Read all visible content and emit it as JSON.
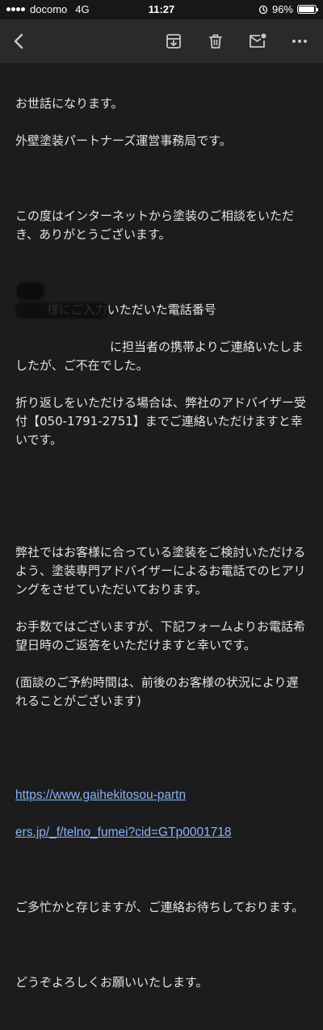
{
  "status_bar": {
    "carrier": "docomo",
    "network": "4G",
    "time": "11:27",
    "battery_percent": "96%",
    "battery_level": 0.96
  },
  "toolbar": {
    "back_icon": "arrow-left-icon",
    "actions": [
      {
        "icon": "archive-icon"
      },
      {
        "icon": "trash-icon"
      },
      {
        "icon": "mark-unread-icon"
      },
      {
        "icon": "more-icon"
      }
    ]
  },
  "email": {
    "greeting": [
      "お世話になります。",
      "外壁塗装パートナーズ運営事務局です。"
    ],
    "thanks": "この度はインターネットから塗装のご相談をいただき、ありがとうございます。",
    "notice_lines": [
      "様にご入力いただいた電話番号",
      "に担当者の携帯よりご連絡いたしましたが、ご不在でした。",
      "折り返しをいただける場合は、弊社のアドバイザー受付【050-1791-2751】までご連絡いただけますと幸いです。"
    ],
    "request_lines": [
      "弊社ではお客様に合っている塗装をご検討いただけるよう、塗装専門アドバイザーによるお電話でのヒアリングをさせていただいております。",
      "お手数ではございますが、下記フォームよりお電話希望日時のご返答をいただけますと幸いです。",
      "(面談のご予約時間は、前後のお客様の状況により遅れることがございます)"
    ],
    "link_line1": "https://www.gaihekitosou-partn",
    "link_line2": "ers.jp/_f/telno_fumei?cid=GTp0001718",
    "busy": "ご多忙かと存じますが、ご連絡お待ちしております。",
    "closing": "どうぞよろしくお願いいたします。"
  }
}
